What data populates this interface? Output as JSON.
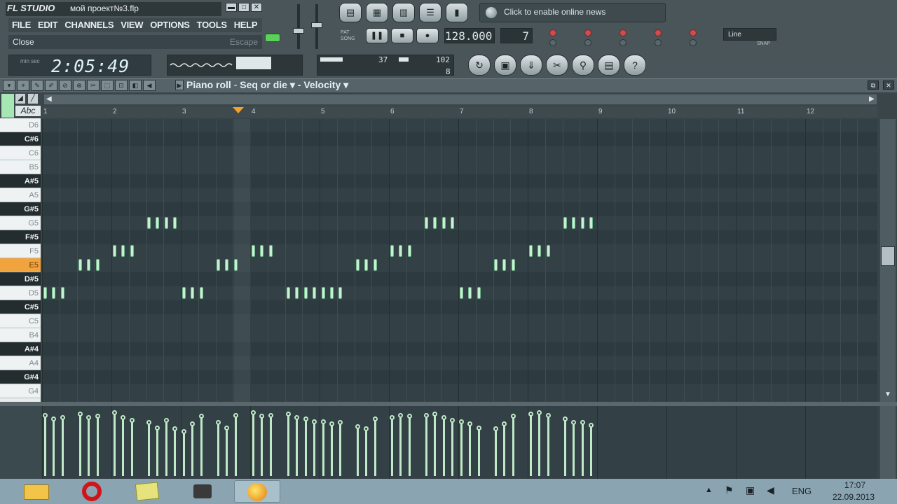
{
  "app": {
    "name": "FL STUDIO",
    "project": "мой проект№3.flp"
  },
  "menu": [
    "FILE",
    "EDIT",
    "CHANNELS",
    "VIEW",
    "OPTIONS",
    "TOOLS",
    "HELP"
  ],
  "hint": {
    "text": "Close",
    "key": "Escape"
  },
  "time": {
    "value": "2:05:49",
    "sub": "min sec"
  },
  "cpu": {
    "value": "37",
    "mem": "102",
    "poly": "8"
  },
  "tempo": "128.000",
  "pattern": "7",
  "news": "Click to enable online news",
  "snap": {
    "value": "Line",
    "label": "SNAP"
  },
  "piano_roll": {
    "title": "Piano roll",
    "target": "Seq or die",
    "property": "Velocity"
  },
  "bars": [
    "1",
    "2",
    "3",
    "4",
    "5",
    "6",
    "7",
    "8",
    "9",
    "10",
    "11",
    "12"
  ],
  "keys": [
    "D6",
    "C#6",
    "C6",
    "B5",
    "A#5",
    "A5",
    "G#5",
    "G5",
    "F#5",
    "F5",
    "E5",
    "D#5",
    "D5",
    "C#5",
    "C5",
    "B4",
    "A#4",
    "A4",
    "G#4",
    "G4"
  ],
  "keyboard_label": "Abc",
  "taskbar": {
    "lang": "ENG",
    "time": "17:07",
    "date": "22.09.2013"
  }
}
